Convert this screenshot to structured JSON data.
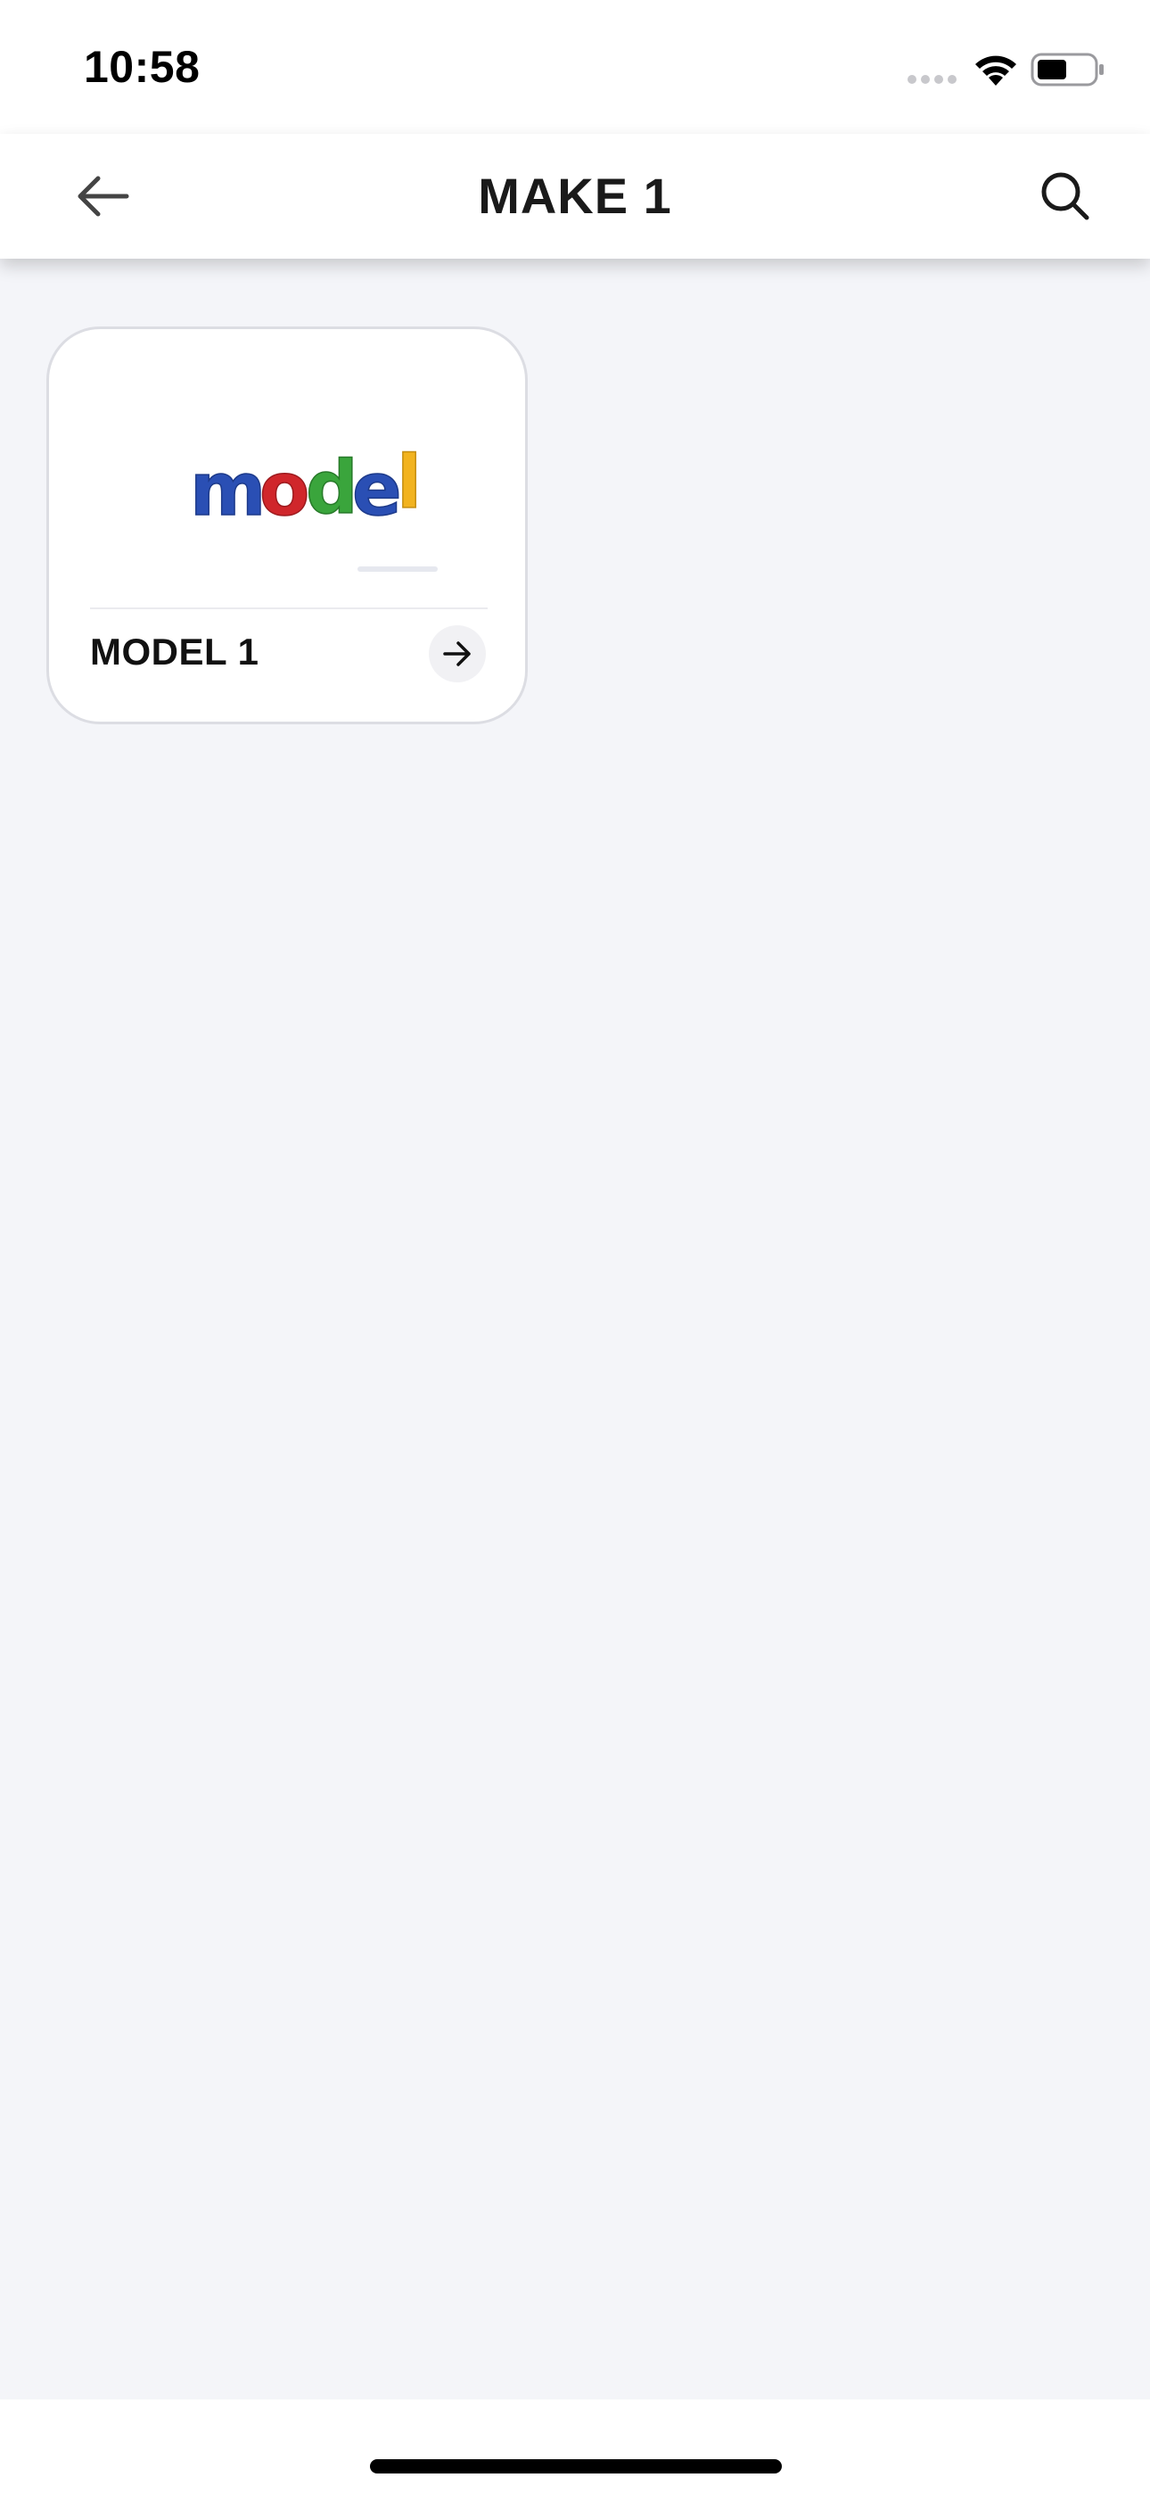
{
  "status_bar": {
    "time": "10:58"
  },
  "header": {
    "title": "MAKE 1",
    "back_icon": "arrow-left-icon",
    "search_icon": "search-icon"
  },
  "cards": [
    {
      "image_text": "model",
      "image_letter_colors": [
        "#2a4fb4",
        "#2a4fb4",
        "#d0262b",
        "#3aa53c",
        "#2a4fb4",
        "#f2b31f"
      ],
      "label": "MODEL 1",
      "arrow_icon": "arrow-right-icon"
    }
  ],
  "colors": {
    "background": "#f4f5f9",
    "surface": "#ffffff",
    "text": "#1a1a1a"
  }
}
